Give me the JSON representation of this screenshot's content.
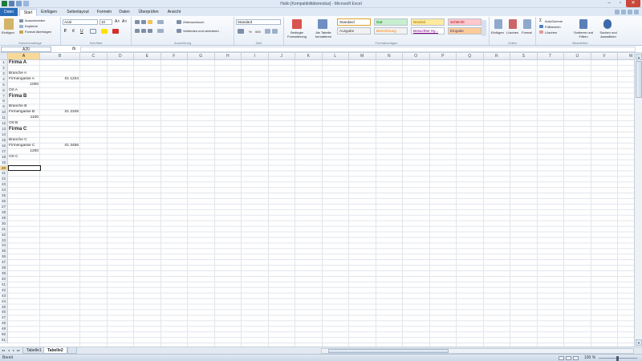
{
  "window": {
    "title": "Hallo [Kompatibilitätsmodus] - Microsoft Excel"
  },
  "tabs": {
    "file": "Datei",
    "items": [
      "Start",
      "Einfügen",
      "Seitenlayout",
      "Formeln",
      "Daten",
      "Überprüfen",
      "Ansicht"
    ],
    "active": "Start"
  },
  "ribbon": {
    "clipboard": {
      "label": "Zwischenablage",
      "paste": "Einfügen",
      "cut": "Ausschneiden",
      "copy": "Kopieren",
      "format_painter": "Format übertragen"
    },
    "font": {
      "label": "Schriftart",
      "name": "Arial",
      "size": "10",
      "bold": "F",
      "italic": "K",
      "underline": "U"
    },
    "alignment": {
      "label": "Ausrichtung",
      "wrap": "Zeilenumbruch",
      "merge": "Verbinden und zentrieren"
    },
    "number": {
      "label": "Zahl",
      "format": "Standard",
      "percent": "%",
      "thousands": "000"
    },
    "styles": {
      "label": "Formatvorlagen",
      "conditional": "Bedingte Formatierung",
      "as_table": "Als Tabelle formatieren",
      "items": [
        {
          "text": "Standard",
          "bg": "#ffffff",
          "fg": "#1e1e1e"
        },
        {
          "text": "Gut",
          "bg": "#c6efce",
          "fg": "#006100"
        },
        {
          "text": "Neutral",
          "bg": "#ffeb9c",
          "fg": "#9c6500"
        },
        {
          "text": "Schlecht",
          "bg": "#ffc7ce",
          "fg": "#9c0006"
        },
        {
          "text": "Ausgabe",
          "bg": "#f2f2f2",
          "fg": "#3f3f3f"
        },
        {
          "text": "Berechnung",
          "bg": "#f2f2f2",
          "fg": "#fa7d00"
        },
        {
          "text": "Besuchter Hy...",
          "bg": "#ffffff",
          "fg": "#800080"
        },
        {
          "text": "Eingabe",
          "bg": "#ffcc99",
          "fg": "#3f3f76"
        }
      ]
    },
    "cells": {
      "label": "Zellen",
      "insert": "Einfügen",
      "delete": "Löschen",
      "format": "Format"
    },
    "editing": {
      "label": "Bearbeiten",
      "autosum": "AutoSumme",
      "fill": "Füllbereich",
      "clear": "Löschen",
      "sort": "Sortieren und Filtern",
      "find": "Suchen und Auswählen"
    }
  },
  "formula_bar": {
    "name_box": "A20",
    "fx": "fx",
    "value": ""
  },
  "grid": {
    "columns": [
      "A",
      "B",
      "C",
      "D",
      "E",
      "F",
      "G",
      "H",
      "I",
      "J",
      "K",
      "L",
      "M",
      "N",
      "O",
      "P",
      "Q",
      "R",
      "S",
      "T",
      "U",
      "V",
      "W"
    ],
    "active_col": "A",
    "row_count": 51,
    "active_row": 20,
    "cells": [
      {
        "row": 1,
        "col": "A",
        "text": "Firma A",
        "bold": true
      },
      {
        "row": 3,
        "col": "A",
        "text": "Branche A"
      },
      {
        "row": 4,
        "col": "A",
        "text": "Firmengasse A"
      },
      {
        "row": 4,
        "col": "B",
        "text": "01 1234",
        "num": true
      },
      {
        "row": 5,
        "col": "A",
        "text": "1000",
        "num": true
      },
      {
        "row": 6,
        "col": "A",
        "text": "Ort A"
      },
      {
        "row": 7,
        "col": "A",
        "text": "Firma B",
        "bold": true
      },
      {
        "row": 9,
        "col": "A",
        "text": "Branche B"
      },
      {
        "row": 10,
        "col": "A",
        "text": "Firmengasse B"
      },
      {
        "row": 10,
        "col": "B",
        "text": "01 2345",
        "num": true
      },
      {
        "row": 11,
        "col": "A",
        "text": "1100",
        "num": true
      },
      {
        "row": 12,
        "col": "A",
        "text": "Ort B"
      },
      {
        "row": 13,
        "col": "A",
        "text": "Firma C",
        "bold": true
      },
      {
        "row": 15,
        "col": "A",
        "text": "Branche C"
      },
      {
        "row": 16,
        "col": "A",
        "text": "Firmengasse C"
      },
      {
        "row": 16,
        "col": "B",
        "text": "01 3456",
        "num": true
      },
      {
        "row": 17,
        "col": "A",
        "text": "1200",
        "num": true
      },
      {
        "row": 18,
        "col": "A",
        "text": "Ort C"
      }
    ]
  },
  "sheets": {
    "items": [
      "Tabelle1",
      "Tabelle2"
    ],
    "active": "Tabelle2"
  },
  "status": {
    "text": "Bereit",
    "zoom": "100 %"
  },
  "icons": [
    "save-icon",
    "undo-icon",
    "redo-icon",
    "paste-icon",
    "scissors-icon",
    "copy-icon",
    "brush-icon",
    "sum-icon",
    "sort-icon",
    "find-icon"
  ]
}
